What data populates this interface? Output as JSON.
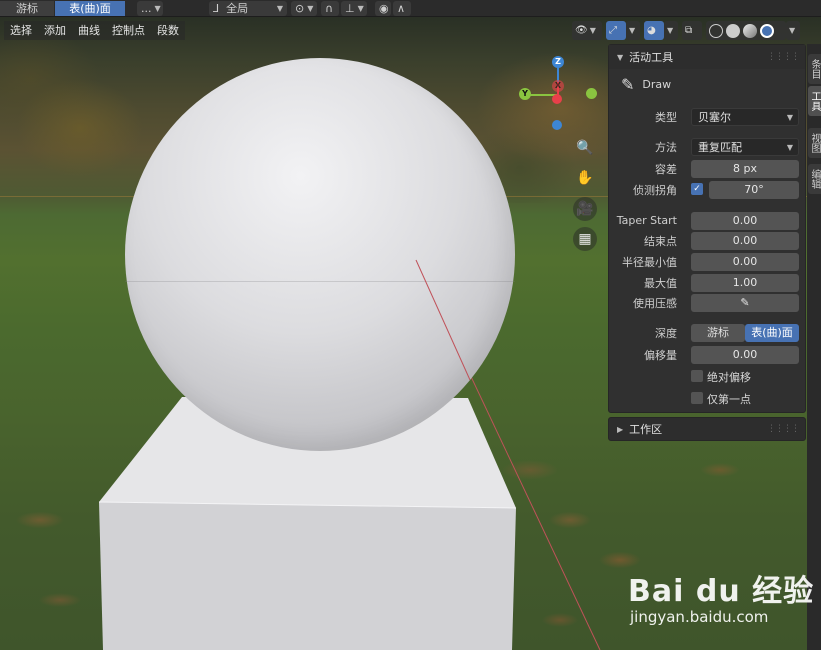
{
  "header": {
    "mode_tabs": [
      "游标",
      "表(曲)面"
    ],
    "more_label": "...",
    "orientation_label": "全局"
  },
  "menubar": {
    "items": [
      "选择",
      "添加",
      "曲线",
      "控制点",
      "段数"
    ]
  },
  "gizmo": {
    "axes": [
      "Z",
      "Y",
      "X"
    ],
    "colors": {
      "x": "#e8404a",
      "y": "#8ac440",
      "z": "#3d86d4"
    }
  },
  "panel": {
    "title": "活动工具",
    "tool_name": "Draw",
    "rows": {
      "type_label": "类型",
      "type_value": "贝塞尔",
      "method_label": "方法",
      "method_value": "重复匹配",
      "tolerance_label": "容差",
      "tolerance_value": "8 px",
      "corner_label": "侦测拐角",
      "corner_value": "70°",
      "taper_start_label": "Taper Start",
      "taper_start_value": "0.00",
      "end_label": "结束点",
      "end_value": "0.00",
      "radius_min_label": "半径最小值",
      "radius_min_value": "0.00",
      "max_label": "最大值",
      "max_value": "1.00",
      "pressure_label": "使用压感",
      "depth_label": "深度",
      "depth_options": [
        "游标",
        "表(曲)面"
      ],
      "offset_label": "偏移量",
      "offset_value": "0.00",
      "abs_offset_label": "绝对偏移",
      "first_point_label": "仅第一点"
    },
    "corner_checked": true,
    "workspace_title": "工作区"
  },
  "side_tabs": [
    "条目",
    "工具",
    "视图",
    "编辑"
  ],
  "watermark": {
    "brand": "Bai du 经验",
    "url": "jingyan.baidu.com"
  }
}
